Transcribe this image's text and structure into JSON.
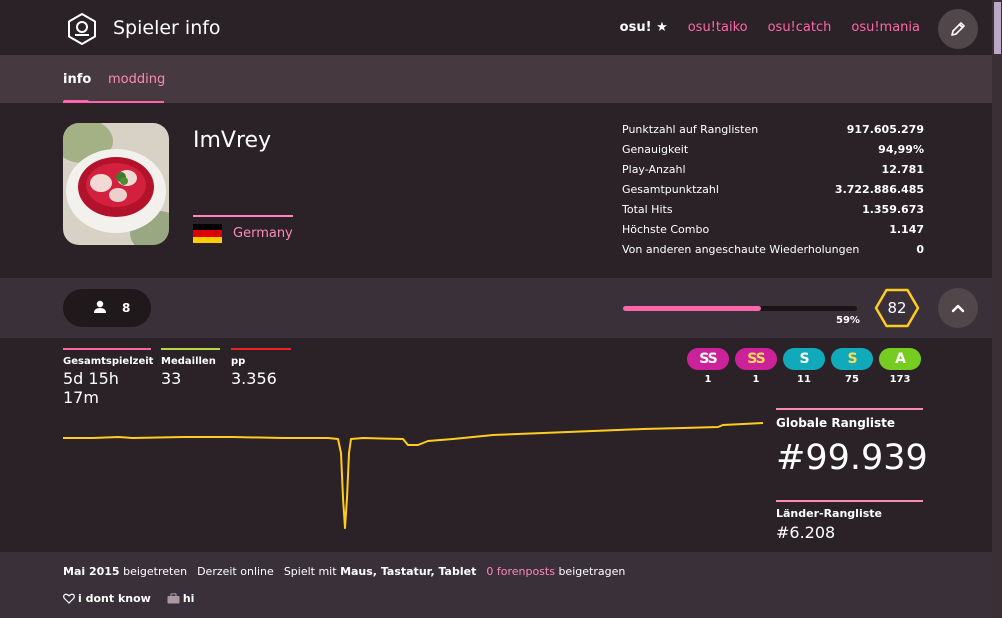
{
  "header": {
    "title": "Spieler info",
    "modes": [
      "osu!",
      "osu!taiko",
      "osu!catch",
      "osu!mania"
    ],
    "active_mode": "osu!"
  },
  "tabs": [
    {
      "label": "info"
    },
    {
      "label": "modding"
    }
  ],
  "profile": {
    "username": "ImVrey",
    "country": "Germany",
    "stats": [
      {
        "label": "Punktzahl auf Ranglisten",
        "value": "917.605.279"
      },
      {
        "label": "Genauigkeit",
        "value": "94,99%"
      },
      {
        "label": "Play-Anzahl",
        "value": "12.781"
      },
      {
        "label": "Gesamtpunktzahl",
        "value": "3.722.886.485"
      },
      {
        "label": "Total Hits",
        "value": "1.359.673"
      },
      {
        "label": "Höchste Combo",
        "value": "1.147"
      },
      {
        "label": "Von anderen angeschaute Wiederholungen",
        "value": "0"
      }
    ]
  },
  "level": {
    "followers": "8",
    "progress_text": "59%",
    "progress": 0.59,
    "level": "82"
  },
  "metrics": [
    {
      "label": "Gesamtspielzeit",
      "value": "5d 15h 17m",
      "color": "#ff66aa"
    },
    {
      "label": "Medaillen",
      "value": "33",
      "color": "#b3d944"
    },
    {
      "label": "pp",
      "value": "3.356",
      "color": "#ee2222"
    }
  ],
  "grades": [
    {
      "grade": "SS",
      "count": "1",
      "bg": "#cc2299",
      "fg": "#ffffff"
    },
    {
      "grade": "SS",
      "count": "1",
      "bg": "#cc2299",
      "fg": "#ffdd55"
    },
    {
      "grade": "S",
      "count": "11",
      "bg": "#11aabb",
      "fg": "#ffffff"
    },
    {
      "grade": "S",
      "count": "75",
      "bg": "#11aabb",
      "fg": "#ffdd55"
    },
    {
      "grade": "A",
      "count": "173",
      "bg": "#77cc22",
      "fg": "#ffffff"
    }
  ],
  "ranking": {
    "global_label": "Globale Rangliste",
    "global_value": "#99.939",
    "country_label": "Länder-Rangliste",
    "country_value": "#6.208"
  },
  "footer": {
    "joined_date": "Mai 2015",
    "joined_suffix": "beigetreten",
    "online": "Derzeit online",
    "plays_prefix": "Spielt mit",
    "plays_with": "Maus, Tastatur, Tablet",
    "forum_posts": "0 forenposts",
    "forum_suffix": "beigetragen",
    "interest": "i dont know",
    "occupation": "hi"
  }
}
